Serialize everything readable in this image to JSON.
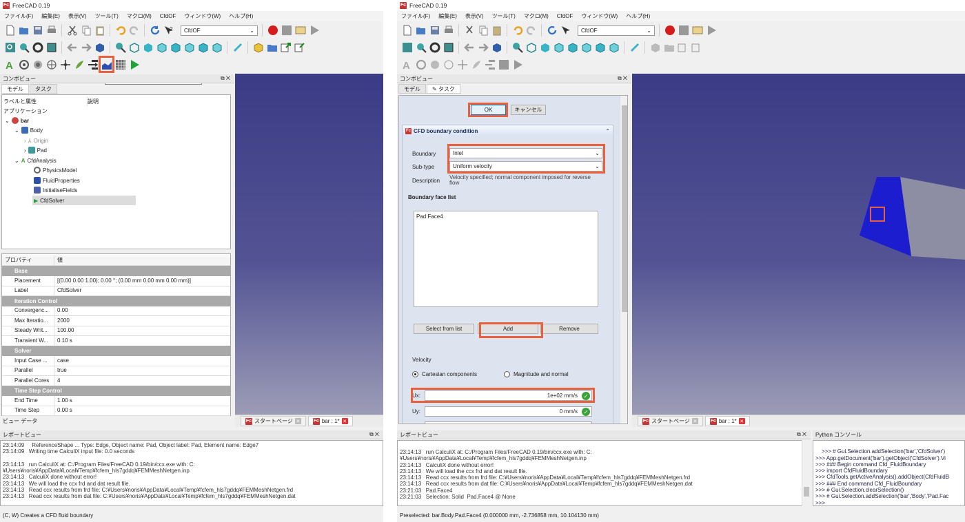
{
  "app_title": "FreeCAD 0.19",
  "menu": [
    "ファイル(F)",
    "編集(E)",
    "表示(V)",
    "ツール(T)",
    "マクロ(M)",
    "CfdOF",
    "ウィンドウ(W)",
    "ヘルプ(H)"
  ],
  "workbench": "CfdOF",
  "tooltip": "Creates a CFD fluid boundary (C, W)",
  "combo_view_title": "コンボビュー",
  "tabs": {
    "model": "モデル",
    "task": "タスク"
  },
  "tree": {
    "col_label": "ラベルと属性",
    "col_desc": "説明",
    "application": "アプリケーション",
    "items": [
      "bar",
      "Body",
      "Origin",
      "Pad",
      "CfdAnalysis",
      "PhysicsModel",
      "FluidProperties",
      "InitialiseFields",
      "CfdSolver"
    ]
  },
  "props": {
    "col_prop": "プロパティ",
    "col_val": "値",
    "groups": {
      "base": "Base",
      "iter": "Iteration Control",
      "solver": "Solver",
      "time": "Time Step Control"
    },
    "rows": [
      {
        "k": "Placement",
        "v": "[(0.00 0.00 1.00); 0.00 °; (0.00 mm  0.00 mm  0.00 mm)]"
      },
      {
        "k": "Label",
        "v": "CfdSolver"
      },
      {
        "k": "Convergenc...",
        "v": "0.00"
      },
      {
        "k": "Max Iteratio...",
        "v": "2000"
      },
      {
        "k": "Steady Writ...",
        "v": "100.00"
      },
      {
        "k": "Transient W...",
        "v": "0.10 s"
      },
      {
        "k": "Input Case ...",
        "v": "case"
      },
      {
        "k": "Parallel",
        "v": "true"
      },
      {
        "k": "Parallel Cores",
        "v": "4"
      },
      {
        "k": "End Time",
        "v": "1.00 s"
      },
      {
        "k": "Time Step",
        "v": "0.00 s"
      }
    ]
  },
  "bottom_tabs": "ビュー  データ",
  "doc_tabs": {
    "start": "スタートページ",
    "bar": "bar : 1*"
  },
  "report_title": "レポートビュー",
  "report_left": "23:14:09     ReferenceShape ... Type: Edge, Object name: Pad, Object label: Pad, Element name: Edge7\n23:14:09   Writing time CalculiX input file: 0.0 seconds\n\n23:14:13   run CalculiX at: C:/Program Files/FreeCAD 0.19/bin/ccx.exe with: C:\n¥Users¥noris¥AppData¥Local¥Temp¥fcfem_hls7gddq¥FEMMeshNetgen.inp\n23:14:13   CalculiX done without error!\n23:14:13   We will load the ccx frd and dat result file.\n23:14:13   Read ccx results from frd file: C:¥Users¥noris¥AppData¥Local¥Temp¥fcfem_hls7gddq¥FEMMeshNetgen.frd\n23:14:13   Read ccx results from dat file: C:¥Users¥noris¥AppData¥Local¥Temp¥fcfem_hls7gddq¥FEMMeshNetgen.dat",
  "report_right": "23:14:13   run CalculiX at: C:/Program Files/FreeCAD 0.19/bin/ccx.exe with: C:\n¥Users¥noris¥AppData¥Local¥Temp¥fcfem_hls7gddq¥FEMMeshNetgen.inp\n23:14:13   CalculiX done without error!\n23:14:13   We will load the ccx frd and dat result file.\n23:14:13   Read ccx results from frd file: C:¥Users¥noris¥AppData¥Local¥Temp¥fcfem_hls7gddq¥FEMMeshNetgen.frd\n23:14:13   Read ccx results from dat file: C:¥Users¥noris¥AppData¥Local¥Temp¥fcfem_hls7gddq¥FEMMeshNetgen.dat\n23:21:03   Pad.Face4\n23:21:03   Selection: Solid  Pad.Face4 @ None",
  "python_title": "Python コンソール",
  "python": ">>> # Gui.Selection.addSelection('bar','CfdSolver')\n>>> App.getDocument('bar').getObject('CfdSolver').Vi\n>>> ### Begin command Cfd_FluidBoundary\n>>> import CfdFluidBoundary\n>>> CfdTools.getActiveAnalysis().addObject(CfdFluidB\n>>> ### End command Cfd_FluidBoundary\n>>> # Gui.Selection.clearSelection()\n>>> # Gui.Selection.addSelection('bar','Body','Pad.Fac\n>>> ",
  "status_left": "(C, W) Creates a CFD fluid boundary",
  "status_right": "Preselected: bar.Body.Pad.Face4 (0.000000 mm, -2.736858 mm, 10.104130 mm)",
  "task": {
    "ok": "OK",
    "cancel": "キャンセル",
    "panel_title": "CFD boundary condition",
    "boundary_label": "Boundary",
    "boundary_value": "Inlet",
    "subtype_label": "Sub-type",
    "subtype_value": "Uniform velocity",
    "desc_label": "Description",
    "desc_value": "Velocity specified; normal component imposed for reverse flow",
    "face_list_title": "Boundary face list",
    "face_item": "Pad:Face4",
    "select_btn": "Select from list",
    "add_btn": "Add",
    "remove_btn": "Remove",
    "velocity_label": "Velocity",
    "cartesian": "Cartesian components",
    "magnitude": "Magnitude and normal",
    "ux_label": "Ux:",
    "ux_value": "1e+02 mm/s",
    "uy_label": "Uy:",
    "uy_value": "0 mm/s"
  }
}
